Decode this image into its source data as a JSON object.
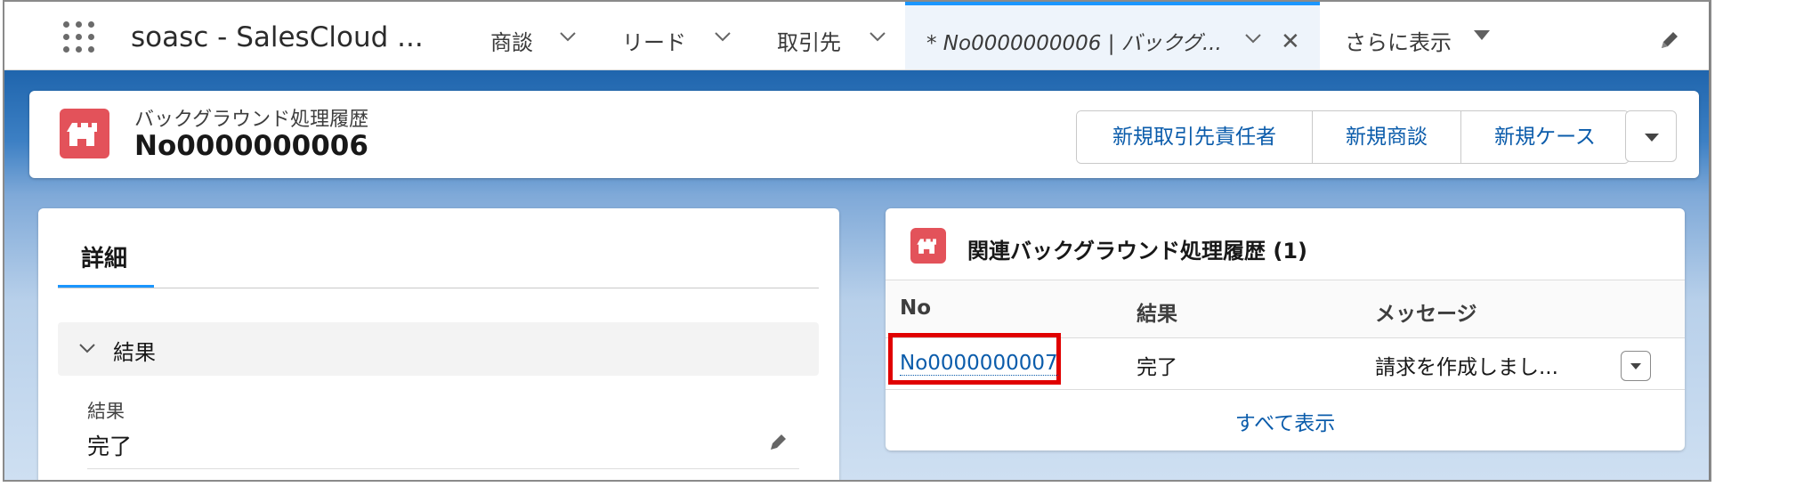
{
  "nav": {
    "app_name": "soasc - SalesCloud ...",
    "items": [
      "商談",
      "リード",
      "取引先"
    ],
    "active_tab": "* No0000000006 | バックグ...",
    "more_label": "さらに表示"
  },
  "header": {
    "object_label": "バックグラウンド処理履歴",
    "record_name": "No0000000006",
    "actions": [
      "新規取引先責任者",
      "新規商談",
      "新規ケース"
    ]
  },
  "detail": {
    "tab_label": "詳細",
    "section_label": "結果",
    "field_label": "結果",
    "field_value": "完了"
  },
  "related": {
    "title": "関連バックグラウンド処理履歴 (1)",
    "columns": [
      "No",
      "結果",
      "メッセージ"
    ],
    "rows": [
      {
        "no": "No0000000007",
        "result": "完了",
        "message": "請求を作成しまし..."
      }
    ],
    "view_all": "すべて表示"
  },
  "colors": {
    "accent": "#1b96ff",
    "link": "#0b5cab",
    "object_icon": "#e3525a",
    "highlight": "#e00000"
  },
  "icons": [
    "app-launcher-icon",
    "chevron-down-icon",
    "close-icon",
    "caret-down-icon",
    "edit-pencil-icon",
    "custom-object-icon"
  ]
}
